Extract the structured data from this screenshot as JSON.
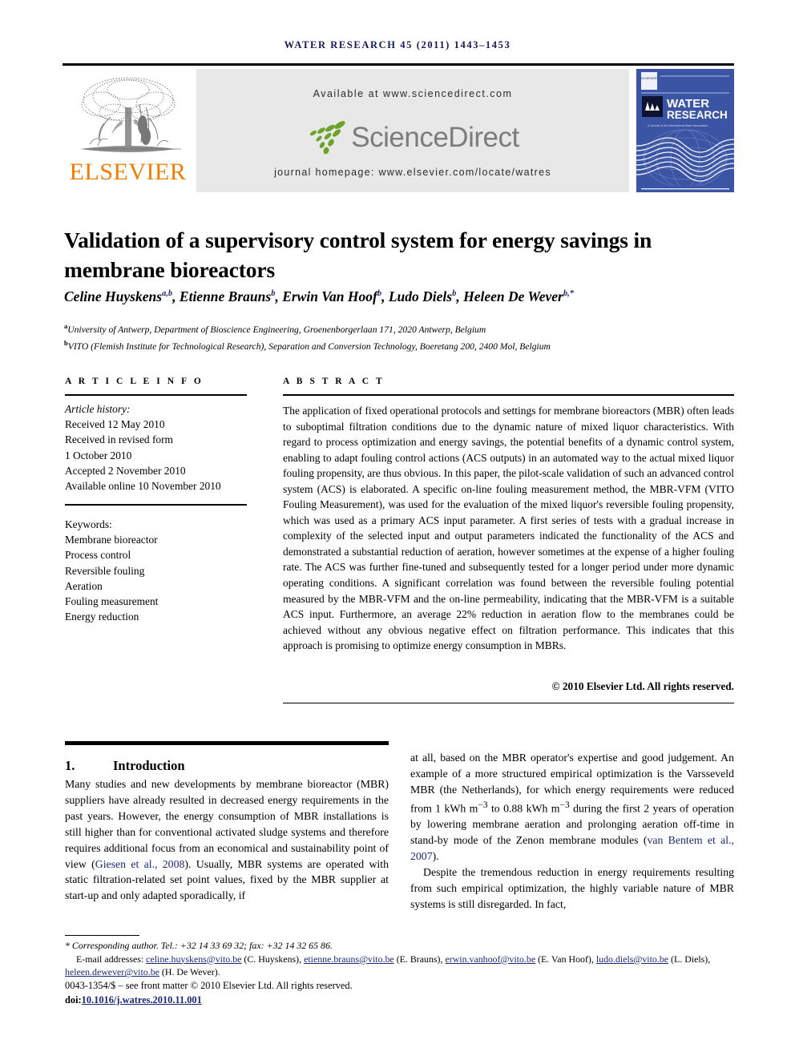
{
  "running_head": "WATER RESEARCH 45 (2011) 1443–1453",
  "masthead": {
    "publisher": "ELSEVIER",
    "available_at": "Available at www.sciencedirect.com",
    "sciencedirect_wordmark": "ScienceDirect",
    "journal_homepage": "journal homepage: www.elsevier.com/locate/watres",
    "cover": {
      "society_mark": "IWA",
      "title_line1": "WATER",
      "title_line2": "RESEARCH",
      "strapline": "A Journal of the International Water Association"
    },
    "colors": {
      "band_background": "#e8e8e8",
      "elsevier_orange": "#f07d00",
      "sciencedirect_green": "#6aa32a",
      "sciencedirect_gray": "#7c7c7c",
      "cover_blue": "#3b55a4",
      "link_navy": "#1a2a7a"
    }
  },
  "article": {
    "title": "Validation of a supervisory control system for energy savings in membrane bioreactors",
    "authors_html": "Celine Huyskens<sup>a,b</sup>, Etienne Brauns<sup>b</sup>, Erwin Van Hoof<sup>b</sup>, Ludo Diels<sup>b</sup>, Heleen De Wever<sup>b,*</sup>",
    "affiliations": [
      {
        "marker": "a",
        "text": "University of Antwerp, Department of Bioscience Engineering, Groenenborgerlaan 171, 2020 Antwerp, Belgium"
      },
      {
        "marker": "b",
        "text": "VITO (Flemish Institute for Technological Research), Separation and Conversion Technology, Boeretang 200, 2400 Mol, Belgium"
      }
    ]
  },
  "article_info": {
    "heading": "A R T I C L E   I N F O",
    "history_label": "Article history:",
    "history": [
      "Received 12 May 2010",
      "Received in revised form",
      "1 October 2010",
      "Accepted 2 November 2010",
      "Available online 10 November 2010"
    ],
    "keywords_label": "Keywords:",
    "keywords": [
      "Membrane bioreactor",
      "Process control",
      "Reversible fouling",
      "Aeration",
      "Fouling measurement",
      "Energy reduction"
    ]
  },
  "abstract": {
    "heading": "A B S T R A C T",
    "text": "The application of fixed operational protocols and settings for membrane bioreactors (MBR) often leads to suboptimal filtration conditions due to the dynamic nature of mixed liquor characteristics. With regard to process optimization and energy savings, the potential benefits of a dynamic control system, enabling to adapt fouling control actions (ACS outputs) in an automated way to the actual mixed liquor fouling propensity, are thus obvious. In this paper, the pilot-scale validation of such an advanced control system (ACS) is elaborated. A specific on-line fouling measurement method, the MBR-VFM (VITO Fouling Measurement), was used for the evaluation of the mixed liquor's reversible fouling propensity, which was used as a primary ACS input parameter. A first series of tests with a gradual increase in complexity of the selected input and output parameters indicated the functionality of the ACS and demonstrated a substantial reduction of aeration, however sometimes at the expense of a higher fouling rate. The ACS was further fine-tuned and subsequently tested for a longer period under more dynamic operating conditions. A significant correlation was found between the reversible fouling potential measured by the MBR-VFM and the on-line permeability, indicating that the MBR-VFM is a suitable ACS input. Furthermore, an average 22% reduction in aeration flow to the membranes could be achieved without any obvious negative effect on filtration performance. This indicates that this approach is promising to optimize energy consumption in MBRs.",
    "copyright": "© 2010 Elsevier Ltd. All rights reserved."
  },
  "body": {
    "section_number": "1.",
    "section_title": "Introduction",
    "left_column": "Many studies and new developments by membrane bioreactor (MBR) suppliers have already resulted in decreased energy requirements in the past years. However, the energy consumption of MBR installations is still higher than for conventional activated sludge systems and therefore requires additional focus from an economical and sustainability point of view (Giesen et al., 2008). Usually, MBR systems are operated with static filtration-related set point values, fixed by the MBR supplier at start-up and only adapted sporadically, if",
    "right_column_p1_html": "at all, based on the MBR operator's expertise and good judgement. An example of a more structured empirical optimization is the Varsseveld MBR (the Netherlands), for which energy requirements were reduced from 1 kWh m<sup>−3</sup> to 0.88 kWh m<sup>−3</sup> during the first 2 years of operation by lowering membrane aeration and prolonging aeration off-time in stand-by mode of the Zenon membrane modules (<span class=\"cite\">van Bentem et al., 2007</span>).",
    "right_column_p2": "Despite the tremendous reduction in energy requirements resulting from such empirical optimization, the highly variable nature of MBR systems is still disregarded. In fact,",
    "citation_left": "Giesen et al., 2008"
  },
  "footnotes": {
    "corresponding_author": "* Corresponding author. Tel.: +32 14 33 69 32; fax: +32 14 32 65 86.",
    "email_label": "E-mail addresses:",
    "emails": [
      {
        "address": "celine.huyskens@vito.be",
        "name": "(C. Huyskens)"
      },
      {
        "address": "etienne.brauns@vito.be",
        "name": "(E. Brauns)"
      },
      {
        "address": "erwin.vanhoof@vito.be",
        "name": "(E. Van Hoof)"
      },
      {
        "address": "ludo.diels@vito.be",
        "name": "(L. Diels)"
      },
      {
        "address": "heleen.dewever@vito.be",
        "name": "(H. De Wever)"
      }
    ],
    "imprint": "0043-1354/$ – see front matter © 2010 Elsevier Ltd. All rights reserved.",
    "doi_label": "doi:",
    "doi": "10.1016/j.watres.2010.11.001"
  }
}
